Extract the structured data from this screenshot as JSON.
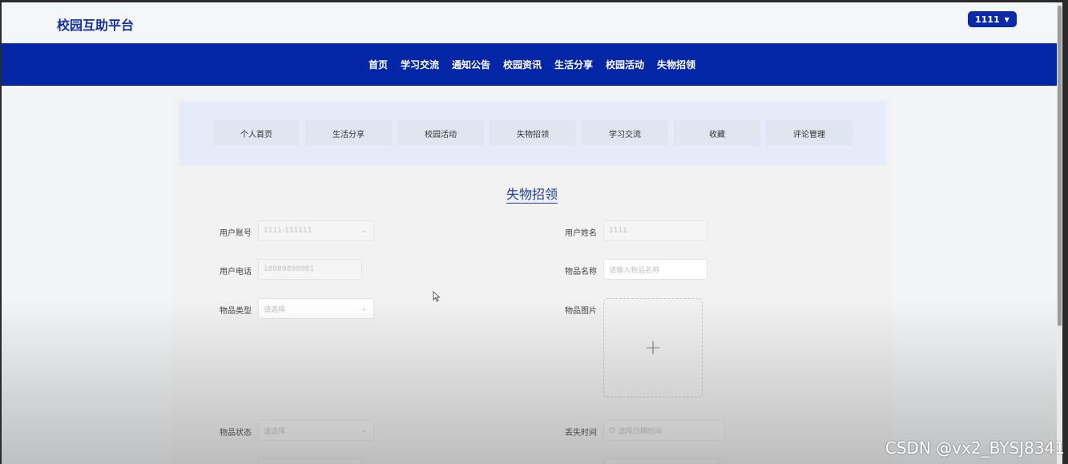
{
  "header": {
    "logo": "校园互助平台",
    "user_menu_label": "1111"
  },
  "nav": {
    "items": [
      "首页",
      "学习交流",
      "通知公告",
      "校园资讯",
      "生活分享",
      "校园活动",
      "失物招领"
    ]
  },
  "subnav": {
    "tabs": [
      "个人首页",
      "生活分享",
      "校园活动",
      "失物招领",
      "学习交流",
      "收藏",
      "评论管理"
    ]
  },
  "form": {
    "title": "失物招领",
    "user_account": {
      "label": "用户账号",
      "value": "1111-111111"
    },
    "user_name": {
      "label": "用户姓名",
      "value": "1111"
    },
    "user_phone": {
      "label": "用户电话",
      "value": "18989898981"
    },
    "item_name": {
      "label": "物品名称",
      "placeholder": "请输入物品名称"
    },
    "item_type": {
      "label": "物品类型",
      "placeholder": "请选择"
    },
    "item_image": {
      "label": "物品图片",
      "upload_symbol": "+"
    },
    "item_status": {
      "label": "物品状态",
      "placeholder": "请选择"
    },
    "lost_time": {
      "label": "丢失时间",
      "placeholder": "选择日期时间"
    }
  },
  "watermark": "CSDN @vx2_BYSJ8341"
}
